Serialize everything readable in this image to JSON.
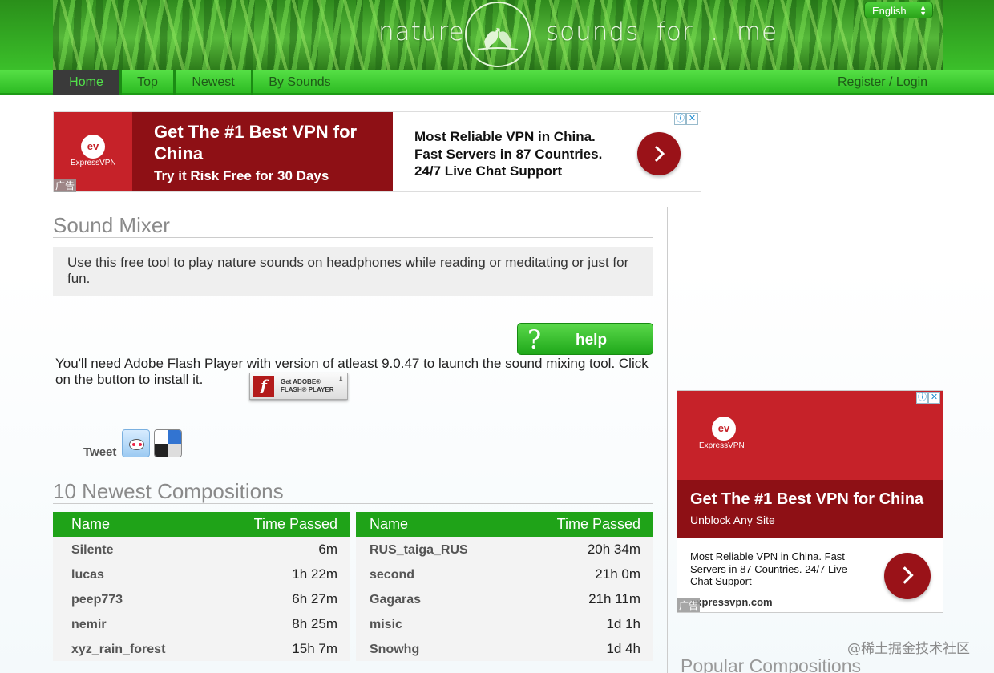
{
  "header": {
    "brand_left": "nature",
    "brand_right": "sounds  for  .  me",
    "language": "English"
  },
  "nav": {
    "items": [
      {
        "label": "Home",
        "active": true
      },
      {
        "label": "Top",
        "active": false
      },
      {
        "label": "Newest",
        "active": false
      },
      {
        "label": "By Sounds",
        "active": false
      }
    ],
    "login": "Register / Login"
  },
  "ad_top": {
    "brand": "ExpressVPN",
    "ad_label": "广告",
    "headline": "Get The #1 Best VPN for China",
    "subline": "Try it Risk Free for 30 Days",
    "body_lines": [
      "Most Reliable VPN in China.",
      "Fast Servers in 87 Countries.",
      "24/7 Live Chat Support"
    ]
  },
  "sound_mixer": {
    "title": "Sound Mixer",
    "intro": "Use this free tool to play nature sounds on headphones while reading or meditating or just for fun.",
    "help_label": "help",
    "help_icon": "?",
    "flash_text": "You'll need Adobe Flash Player with version of atleast 9.0.47 to launch the sound mixing tool. Click on the button to install it.",
    "flash_badge_line1": "Get ADOBE®",
    "flash_badge_line2": "FLASH® PLAYER"
  },
  "share": {
    "tweet": "Tweet"
  },
  "newest": {
    "title": "10 Newest Compositions",
    "col_name": "Name",
    "col_time": "Time Passed",
    "left": [
      {
        "name": "Silente",
        "time": "6m"
      },
      {
        "name": "lucas",
        "time": "1h 22m"
      },
      {
        "name": "peep773",
        "time": "6h 27m"
      },
      {
        "name": "nemir",
        "time": "8h 25m"
      },
      {
        "name": "xyz_rain_forest",
        "time": "15h 7m"
      }
    ],
    "right": [
      {
        "name": "RUS_taiga_RUS",
        "time": "20h 34m"
      },
      {
        "name": "second",
        "time": "21h 0m"
      },
      {
        "name": "Gagaras",
        "time": "21h 11m"
      },
      {
        "name": "misic",
        "time": "1d 1h"
      },
      {
        "name": "Snowhg",
        "time": "1d 4h"
      }
    ]
  },
  "ad_side": {
    "brand": "ExpressVPN",
    "ad_label": "广告",
    "headline": "Get The #1 Best VPN for China",
    "subline": "Unblock Any Site",
    "body": "Most Reliable VPN in China. Fast Servers in 87 Countries. 24/7 Live Chat Support",
    "domain": "expressvpn.com"
  },
  "popular": {
    "title": "Popular Compositions"
  },
  "watermark": "@稀土掘金技术社区",
  "colors": {
    "nav_green": "#2dbb23",
    "table_header": "#1fa318",
    "ad_red": "#c62229",
    "ad_dark_red": "#8e1015"
  }
}
